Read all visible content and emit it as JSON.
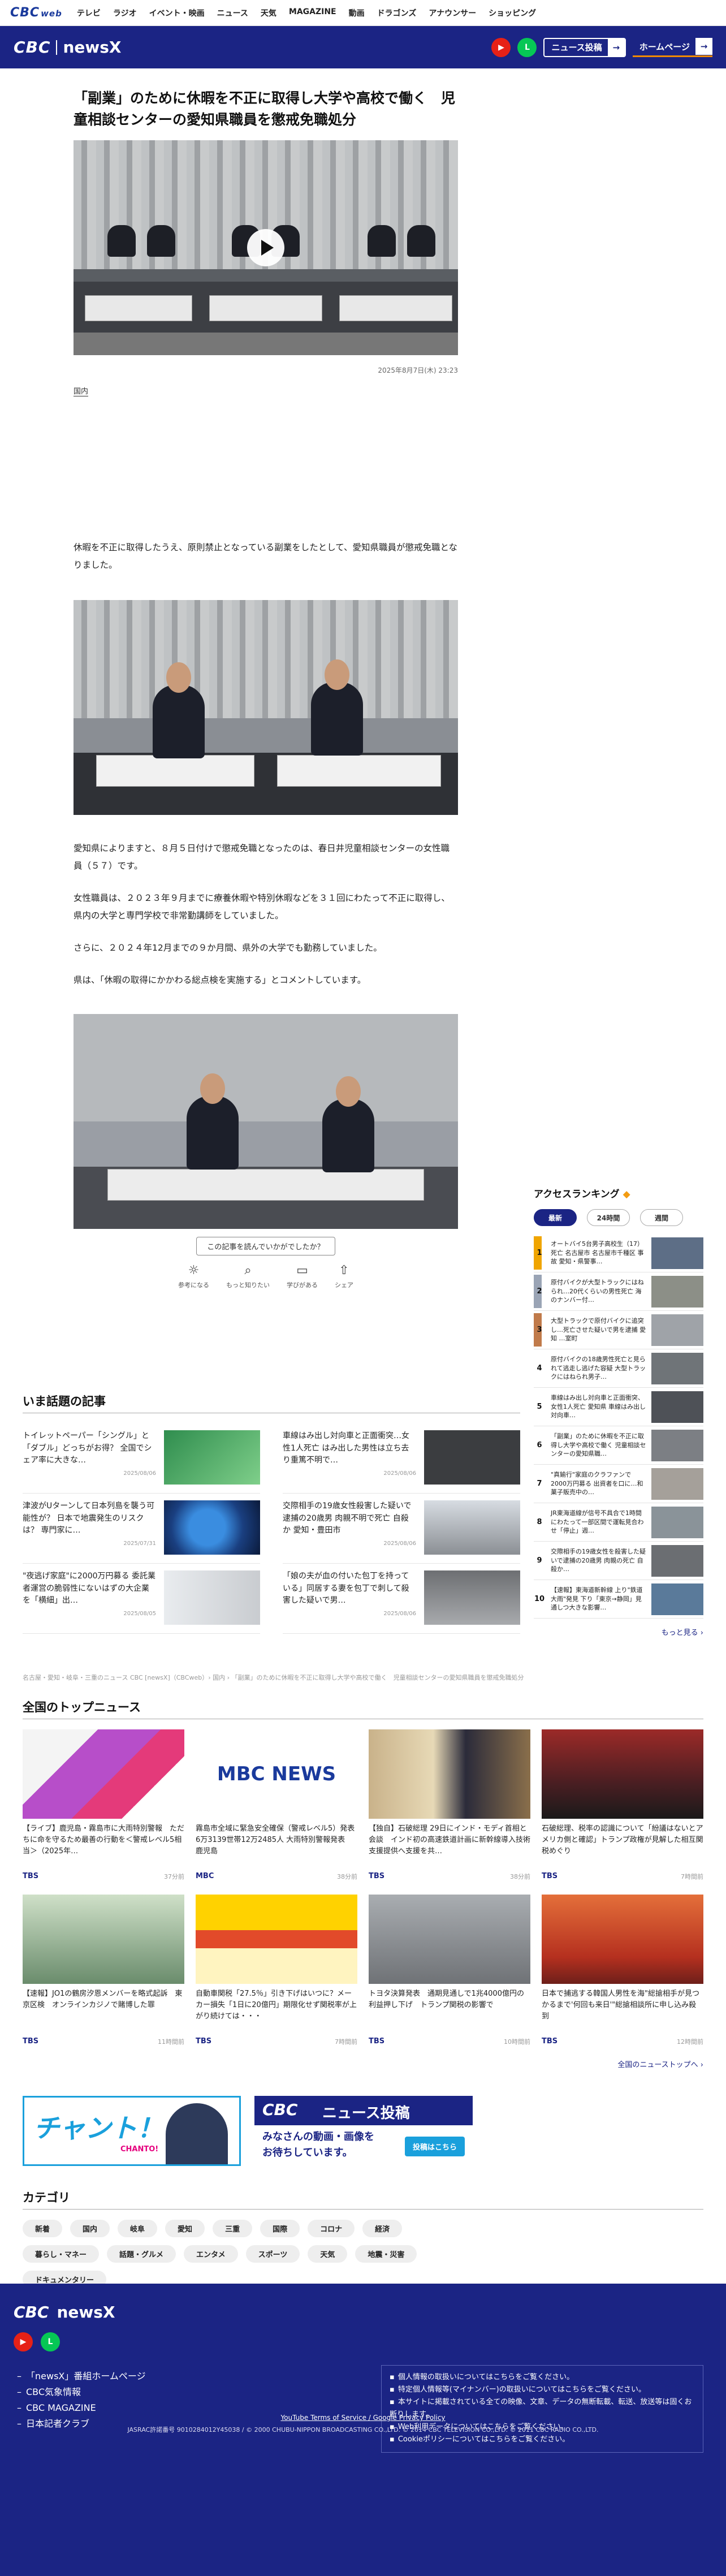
{
  "topnav": {
    "logo": "CBC",
    "logo_sub": "web",
    "items": [
      "テレビ",
      "ラジオ",
      "イベント・映画",
      "ニュース",
      "天気",
      "MAGAZINE",
      "動画",
      "ドラゴンズ",
      "アナウンサー",
      "ショッピング"
    ]
  },
  "header": {
    "logo": "CBC",
    "brand": "newsX",
    "youtube_icon": "youtube-icon",
    "line_icon": "line-icon",
    "post_button": "ニュース投稿",
    "home_button": "ホームページ"
  },
  "article": {
    "title": "「副業」のために休暇を不正に取得し大学や高校で働く　児童相談センターの愛知県職員を懲戒免職処分",
    "date": "2025年8月7日(木) 23:23",
    "category": "国内",
    "paragraphs": [
      "休暇を不正に取得したうえ、原則禁止となっている副業をしたとして、愛知県職員が懲戒免職となりました。",
      "愛知県によりますと、８月５日付けで懲戒免職となったのは、春日井児童相談センターの女性職員（５７）です。",
      "女性職員は、２０２３年９月までに療養休暇や特別休暇などを３１回にわたって不正に取得し、県内の大学と専門学校で非常勤講師をしていました。",
      "さらに、２０２４年12月までの９か月間、県外の大学でも勤務していました。",
      "県は、「休暇の取得にかかわる総点検を実施する」とコメントしています。"
    ],
    "read_question": "この記事を読んでいかがでしたか？",
    "reactions": [
      {
        "icon": "bulb-icon",
        "label": "参考になる"
      },
      {
        "icon": "search-icon",
        "label": "もっと知りたい"
      },
      {
        "icon": "book-icon",
        "label": "学びがある"
      },
      {
        "icon": "share-icon",
        "label": "シェア"
      }
    ]
  },
  "ranking": {
    "title": "アクセスランキング",
    "tabs": [
      "最新",
      "24時間",
      "週間"
    ],
    "items": [
      {
        "n": "1",
        "text": "オートバイ5台男子高校生（17）死亡 名古屋市 名古屋市千種区 事故 愛知・県警事…",
        "color": "#f0a500"
      },
      {
        "n": "2",
        "text": "原付バイクが大型トラックにはねられ…20代くらいの男性死亡 海のナンバー付…",
        "color": "#9aa4b5"
      },
      {
        "n": "3",
        "text": "大型トラックで原付バイクに追突し…死亡させた疑いで男を逮捕 愛知 …室町",
        "color": "#c07a4a"
      },
      {
        "n": "4",
        "text": "原付バイクの18歳男性死亡と見られて逃走し逃げた容疑 大型トラックにはねられ男子…",
        "color": ""
      },
      {
        "n": "5",
        "text": "車線はみ出し対向車と正面衝突、女性1人死亡 愛知県 車線はみ出し対向車…",
        "color": ""
      },
      {
        "n": "6",
        "text": "「副業」のために休暇を不正に取得し大学や高校で働く 児童相談センターの愛知県職…",
        "color": ""
      },
      {
        "n": "7",
        "text": "\"真鍮行\"家庭のクラファンで2000万円募る 出資者を口に…和菓子販売中の…",
        "color": ""
      },
      {
        "n": "8",
        "text": "JR東海道線が信号不具合で1時間にわたって一部区間で運転見合わせ「停止」週…",
        "color": ""
      },
      {
        "n": "9",
        "text": "交際相手の19歳女性を殺害した疑いで逮捕の20歳男 肉親の死亡 自殺か…",
        "color": ""
      },
      {
        "n": "10",
        "text": "【速報】東海道新幹線 上り\"鉄道大雨\"発見 下り「東京→静岡」見通しつ大きな影響…",
        "color": ""
      }
    ],
    "more": "もっと見る ›"
  },
  "hot": {
    "title": "いま話題の記事",
    "items": [
      {
        "title": "トイレットペーパー「シングル」と「ダブル」どっちがお得？ 全国でシェア率に大きな…",
        "date": "2025/08/06"
      },
      {
        "title": "車線はみ出し対向車と正面衝突…女性1人死亡 はみ出した男性は立ち去り重篤不明で…",
        "date": "2025/08/06"
      },
      {
        "title": "津波がUターンして日本列島を襲う可能性が？ 日本で地震発生のリスクは？ 専門家に…",
        "date": "2025/07/31"
      },
      {
        "title": "交際相手の19歳女性殺害した疑いで逮捕の20歳男 肉親不明で死亡 自殺か 愛知・豊田市",
        "date": "2025/08/06"
      },
      {
        "title": "\"夜逃げ家庭\"に2000万円募る 委託業者運営の脆弱性にないはずの大企業を「横細」出…",
        "date": "2025/08/05"
      },
      {
        "title": "「娘の夫が血の付いた包丁を持っている」同居する妻を包丁で刺して殺害した疑いで男…",
        "date": "2025/08/06"
      }
    ]
  },
  "breadcrumb": "名古屋・愛知・岐阜・三重のニュース  CBC [newsX]（CBCweb）› 国内 › 「副業」のために休暇を不正に取得し大学や高校で働く　児童相談センターの愛知県職員を懲戒免職処分",
  "topnews": {
    "title": "全国のトップニュース",
    "items": [
      {
        "title": "【ライブ】鹿児島・霧島市に大雨特別警報　ただちに命を守るため最善の行動を＜警戒レベル5相当＞（2025年…",
        "src": "TBS",
        "ago": "37分前"
      },
      {
        "title": "霧島市全域に緊急安全確保（警戒レベル5）発表　6万3139世帯12万2485人 大雨特別警報発表　鹿児島",
        "src": "MBC",
        "ago": "38分前"
      },
      {
        "title": "【独自】石破総理 29日にインド・モディ首相と会談　インド初の高速鉄道計画に新幹線導入技術支援提供へ支援を共…",
        "src": "TBS",
        "ago": "38分前"
      },
      {
        "title": "石破総理、税率の認識について「紛議はないとアメリカ側と確認」トランプ政権が見解した相互関税めぐり",
        "src": "TBS",
        "ago": "7時間前"
      },
      {
        "title": "【速報】JO1の鶴房汐恩メンバーを略式起訴　東京区検　オンラインカジノで賭博した罪",
        "src": "TBS",
        "ago": "11時間前"
      },
      {
        "title": "自動車関税「27.5％」引き下げはいつに？メーカー損失「1日に20億円」期限化せず関税率が上がり続けては・・・",
        "src": "TBS",
        "ago": "7時間前"
      },
      {
        "title": "トヨタ決算発表　通期見通しで1兆4000億円の利益押し下げ　トランプ関税の影響で",
        "src": "TBS",
        "ago": "10時間前"
      },
      {
        "title": "日本で捕逃する韓国人男性を海\"総搶相手が見つかるまで'何回も来日'\"総搶相談所に申し込み殺到",
        "src": "TBS",
        "ago": "12時間前"
      }
    ],
    "more": "全国のニューストップへ ›"
  },
  "banners": {
    "chanto": "チャント！",
    "chanto_sub": "CHANTO!",
    "post_logo": "CBC",
    "post_title": "ニュース投稿",
    "post_line1": "みなさんの動画・画像を",
    "post_line2": "お待ちしています。",
    "post_button": "投稿はこちら"
  },
  "categories": {
    "title": "カテゴリ",
    "items": [
      "新着",
      "国内",
      "岐阜",
      "愛知",
      "三重",
      "国際",
      "コロナ",
      "経済",
      "暮らし・マネー",
      "話題・グルメ",
      "エンタメ",
      "スポーツ",
      "天気",
      "地震・災害",
      "ドキュメンタリー"
    ]
  },
  "footer": {
    "logo": "CBC",
    "brand": "newsX",
    "links": [
      "「newsX」番組ホームページ",
      "CBC気象情報",
      "CBC MAGAZINE",
      "日本記者クラブ"
    ],
    "notices": [
      "個人情報の取扱いについてはこちらをご覧ください。",
      "特定個人情報等(マイナンバー)の取扱いについてはこちらをご覧ください。",
      "本サイトに掲載されている全ての映像、文章、データの無断転載、転送、放送等は固くお断りします。",
      "Web利用データについてはこちらをご覧ください。",
      "Cookieポリシーについてはこちらをご覧ください。"
    ],
    "legal": "YouTube Terms of Service / Google Privacy Policy",
    "copyright": "JASRAC許諾番号 9010284012Y45038 / © 2000 CHUBU-NIPPON BROADCASTING CO.,LTD. © 2014 CBC TELEVISION CO.,LTD. © 2011 CBC RADIO CO.,LTD."
  },
  "colors": {
    "brand": "#1b2484",
    "accent": "#f08a00",
    "youtube": "#e62117",
    "line": "#06c755"
  }
}
